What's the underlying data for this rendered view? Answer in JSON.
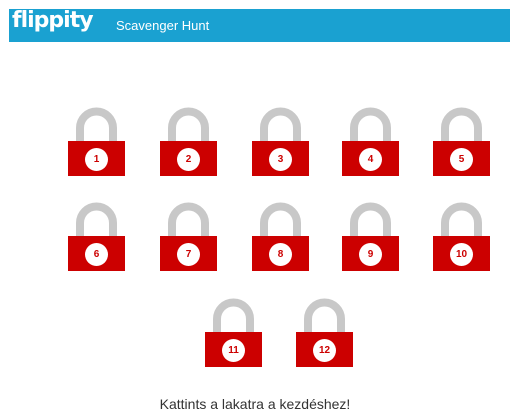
{
  "header": {
    "logo": "flippity",
    "title": "Scavenger Hunt",
    "bg_color": "#1aa1d1"
  },
  "locks": [
    {
      "number": "1"
    },
    {
      "number": "2"
    },
    {
      "number": "3"
    },
    {
      "number": "4"
    },
    {
      "number": "5"
    },
    {
      "number": "6"
    },
    {
      "number": "7"
    },
    {
      "number": "8"
    },
    {
      "number": "9"
    },
    {
      "number": "10"
    },
    {
      "number": "11"
    },
    {
      "number": "12"
    }
  ],
  "lock_colors": {
    "shackle": "#c8c8c8",
    "body": "#cc0000",
    "badge": "#ffffff"
  },
  "instruction": "Kattints a lakatra a kezdéshez!"
}
